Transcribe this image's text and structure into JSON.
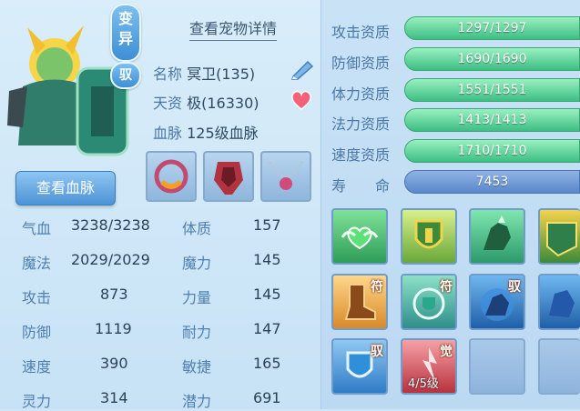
{
  "badges": {
    "mutant": "变异",
    "ride": "驭"
  },
  "detail_link": "查看宠物详情",
  "info": {
    "name_label": "名称",
    "name_value": "冥卫(135)",
    "aptitude_label": "天资",
    "aptitude_value": "极(16330)",
    "blood_label": "血脉",
    "blood_value": "125级血脉"
  },
  "blood_button": "查看血脉",
  "stats": [
    {
      "label": "气血",
      "value": "3238/3238",
      "label2": "体质",
      "value2": "157"
    },
    {
      "label": "魔法",
      "value": "2029/2029",
      "label2": "魔力",
      "value2": "145"
    },
    {
      "label": "攻击",
      "value": "873",
      "label2": "力量",
      "value2": "145"
    },
    {
      "label": "防御",
      "value": "1119",
      "label2": "耐力",
      "value2": "147"
    },
    {
      "label": "速度",
      "value": "390",
      "label2": "敏捷",
      "value2": "165"
    },
    {
      "label": "灵力",
      "value": "314",
      "label2": "潜力",
      "value2": "691"
    }
  ],
  "aptitudes": [
    {
      "label": "攻击资质",
      "value": "1297/1297"
    },
    {
      "label": "防御资质",
      "value": "1690/1690"
    },
    {
      "label": "体力资质",
      "value": "1551/1551"
    },
    {
      "label": "法力资质",
      "value": "1413/1413"
    },
    {
      "label": "速度资质",
      "value": "1710/1710"
    }
  ],
  "life": {
    "label": "寿　　命",
    "value": "7453"
  },
  "skills": {
    "s6_tag": "符",
    "s7_tag": "符",
    "s8_tag": "驭",
    "s10_tag": "驭",
    "s11_tag": "觉",
    "s11_level": "4/5级"
  },
  "colors": {
    "accent": "#4c93d6",
    "bar": "#3cbf83",
    "label": "#4a78a6"
  }
}
